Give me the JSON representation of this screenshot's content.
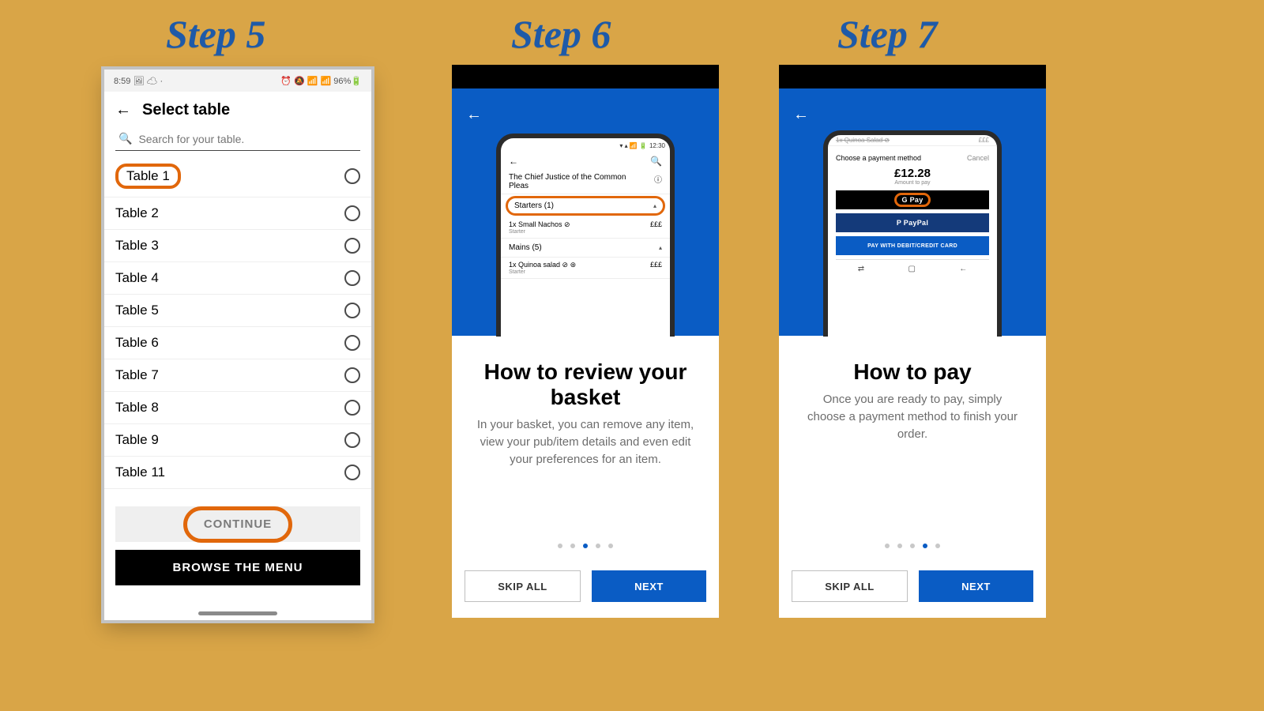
{
  "titles": {
    "s5": "Step 5",
    "s6": "Step 6",
    "s7": "Step 7"
  },
  "step5": {
    "status": {
      "time": "8:59",
      "icons": "🖼 ☁ ·",
      "right": "⏰ 🔕 📶 📶 96%🔋"
    },
    "header": "Select table",
    "search_placeholder": "Search for your table.",
    "tables": [
      "Table 1",
      "Table 2",
      "Table 3",
      "Table 4",
      "Table 5",
      "Table 6",
      "Table 7",
      "Table 8",
      "Table 9",
      "Table 11"
    ],
    "continue": "CONTINUE",
    "browse": "BROWSE THE MENU"
  },
  "step6": {
    "innerStatusTime": "12:30",
    "venue": "The Chief Justice of the Common Pleas",
    "sections": [
      {
        "name": "Starters (1)",
        "items": [
          {
            "name": "1x Small Nachos ⊘",
            "price": "£££",
            "tag": "Starter"
          }
        ]
      },
      {
        "name": "Mains (5)",
        "items": [
          {
            "name": "1x Quinoa salad ⊘ ⊛",
            "price": "£££",
            "tag": "Starter"
          }
        ]
      }
    ],
    "title": "How to review your basket",
    "desc": "In your basket, you can remove any item, view your pub/item details and even edit your preferences for an item.",
    "dotsActive": 2,
    "skip": "SKIP ALL",
    "next": "NEXT"
  },
  "step7": {
    "strike": "1x Quinoa Salad ⊘",
    "payHeader": "Choose a payment method",
    "cancel": "Cancel",
    "amount": "£12.28",
    "amountSub": "Amount to pay",
    "gpay": "G Pay",
    "paypal": "P PayPal",
    "card": "PAY WITH DEBIT/CREDIT CARD",
    "title": "How to pay",
    "desc": "Once you are ready to pay, simply choose a payment method to finish your order.",
    "dotsActive": 3,
    "skip": "SKIP ALL",
    "next": "NEXT"
  }
}
